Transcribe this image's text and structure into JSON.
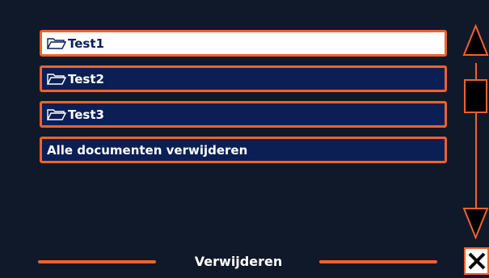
{
  "list": {
    "items": [
      {
        "label": "Test1",
        "icon": "folder-icon",
        "selected": true
      },
      {
        "label": "Test2",
        "icon": "folder-icon",
        "selected": false
      },
      {
        "label": "Test3",
        "icon": "folder-icon",
        "selected": false
      },
      {
        "label": "Alle documenten verwijderen",
        "icon": null,
        "selected": false
      }
    ]
  },
  "footer": {
    "title": "Verwijderen"
  },
  "colors": {
    "accent": "#f0622b",
    "item_bg": "#0b1f55",
    "page_bg": "#10192a",
    "selected_bg": "#ffffff"
  },
  "icons": {
    "scroll_up": "up-arrow-icon",
    "scroll_down": "down-arrow-icon",
    "close": "close-icon"
  }
}
